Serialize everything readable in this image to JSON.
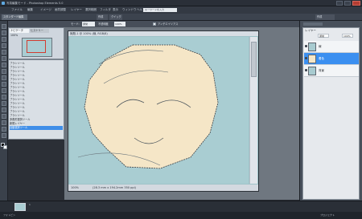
{
  "app": {
    "title": "写真編集モード - Photoshop Elements 5.0"
  },
  "menu": {
    "items": [
      "ファイル",
      "編集",
      "イメージ",
      "画質調整",
      "レイヤー",
      "選択範囲",
      "フィルタ",
      "表示",
      "ウィンドウ",
      "ヘルプ"
    ],
    "search_placeholder": "キーワードを入力"
  },
  "modebar": {
    "left_btn": "スタンダード編集",
    "right_items": [
      "作成",
      "クイック",
      "作成"
    ]
  },
  "options": {
    "mode_label": "モード:",
    "mode_value": "通常",
    "opacity_label": "不透明度",
    "opacity_value": "100%",
    "snap_label": "アンチエイリアス"
  },
  "navigator": {
    "tab": "ナビゲータ",
    "tab2": "ヒストリー",
    "zoom": "100%"
  },
  "history": {
    "items": [
      "ブラシツール",
      "ブラシツール",
      "ブラシツール",
      "ブラシツール",
      "ブラシツール",
      "ブラシツール",
      "ブラシツール",
      "ブラシツール",
      "ブラシツール",
      "ブラシツール",
      "ブラシツール",
      "ブラシツール",
      "ブラシツール",
      "ブラシツール",
      "多角形選択ツール",
      "新規レイヤー",
      "自動選択ツール"
    ]
  },
  "document": {
    "title": "無題-1 @ 100% (線, RGB/8)",
    "zoom": "100%",
    "status": "(28.3 mm x 194.2mm 350 ppi)"
  },
  "layers": {
    "header": "レイヤー",
    "mode": "通常",
    "opacity": "100%",
    "rows": [
      {
        "name": "線"
      },
      {
        "name": "着色"
      },
      {
        "name": "背景"
      }
    ]
  },
  "bin": {
    "label": "1",
    "status_left": "フォトビン",
    "status_right": "プロジェクト"
  }
}
